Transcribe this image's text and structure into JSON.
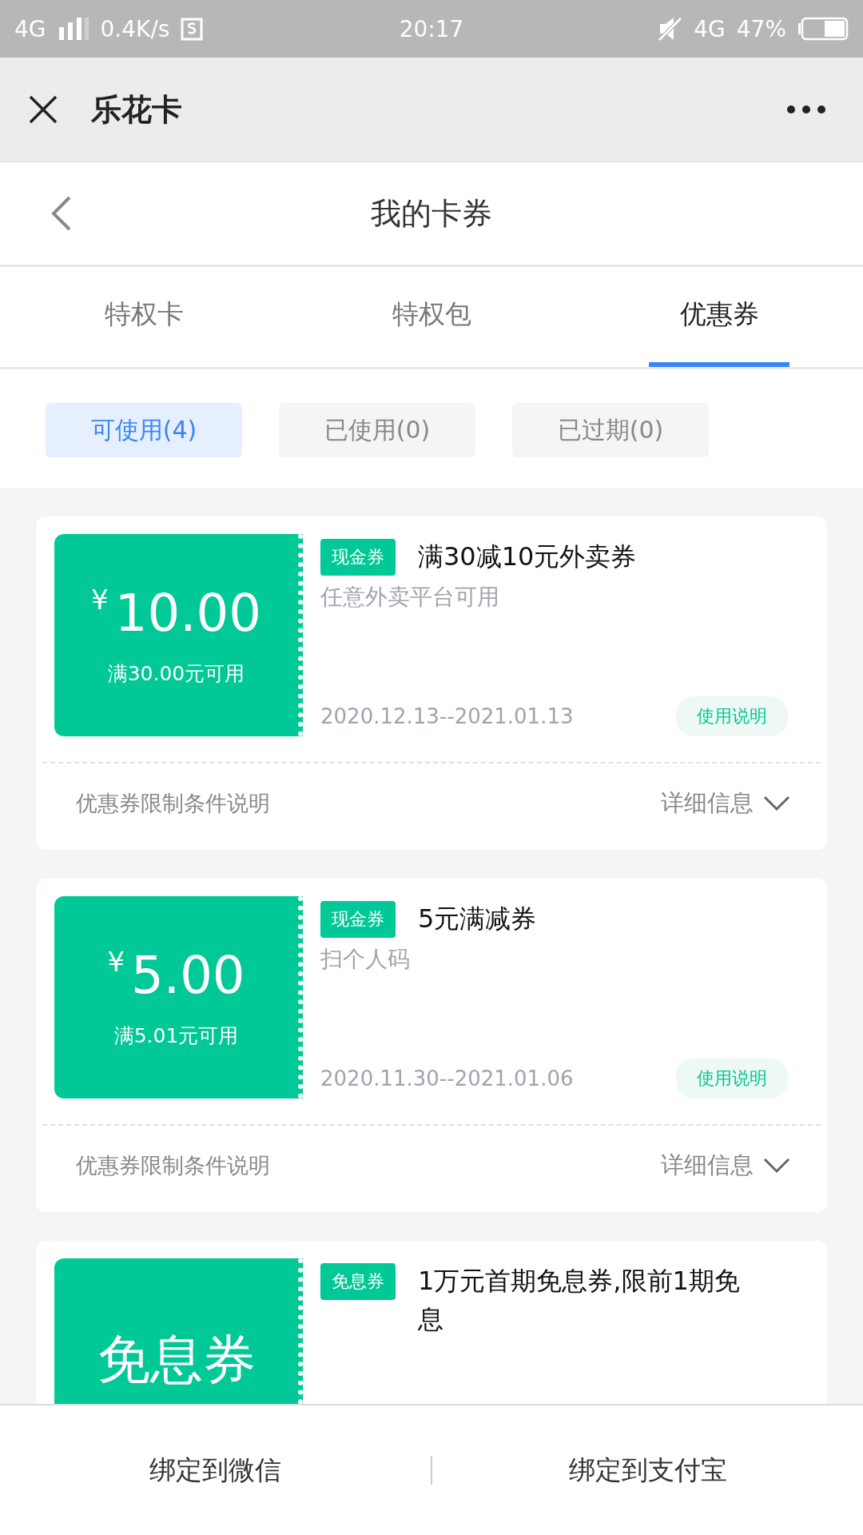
{
  "status_bar": {
    "network": "4G",
    "speed": "0.4K/s",
    "time": "20:17",
    "network_right": "4G",
    "battery": "47%"
  },
  "nav_bar": {
    "title": "乐花卡"
  },
  "header": {
    "title": "我的卡券"
  },
  "tabs": [
    {
      "label": "特权卡",
      "selected": false
    },
    {
      "label": "特权包",
      "selected": false
    },
    {
      "label": "优惠券",
      "selected": true
    }
  ],
  "filters": [
    {
      "label": "可使用(4)",
      "selected": true
    },
    {
      "label": "已使用(0)",
      "selected": false
    },
    {
      "label": "已过期(0)",
      "selected": false
    }
  ],
  "coupons": [
    {
      "kind": "amount",
      "currency": "¥",
      "amount": "10.00",
      "condition": "满30.00元可用",
      "tag": "现金券",
      "title": "满30减10元外卖券",
      "subtitle": "任意外卖平台可用",
      "dates": "2020.12.13--2021.01.13",
      "usage_button": "使用说明",
      "footer_label": "优惠券限制条件说明",
      "details_link": "详细信息"
    },
    {
      "kind": "amount",
      "currency": "¥",
      "amount": "5.00",
      "condition": "满5.01元可用",
      "tag": "现金券",
      "title": "5元满减券",
      "subtitle": "扫个人码",
      "dates": "2020.11.30--2021.01.06",
      "usage_button": "使用说明",
      "footer_label": "优惠券限制条件说明",
      "details_link": "详细信息"
    },
    {
      "kind": "label",
      "label": "免息券",
      "tag": "免息券",
      "title": "1万元首期免息券,限前1期免息"
    }
  ],
  "bottom_buttons": [
    "绑定到微信",
    "绑定到支付宝"
  ]
}
